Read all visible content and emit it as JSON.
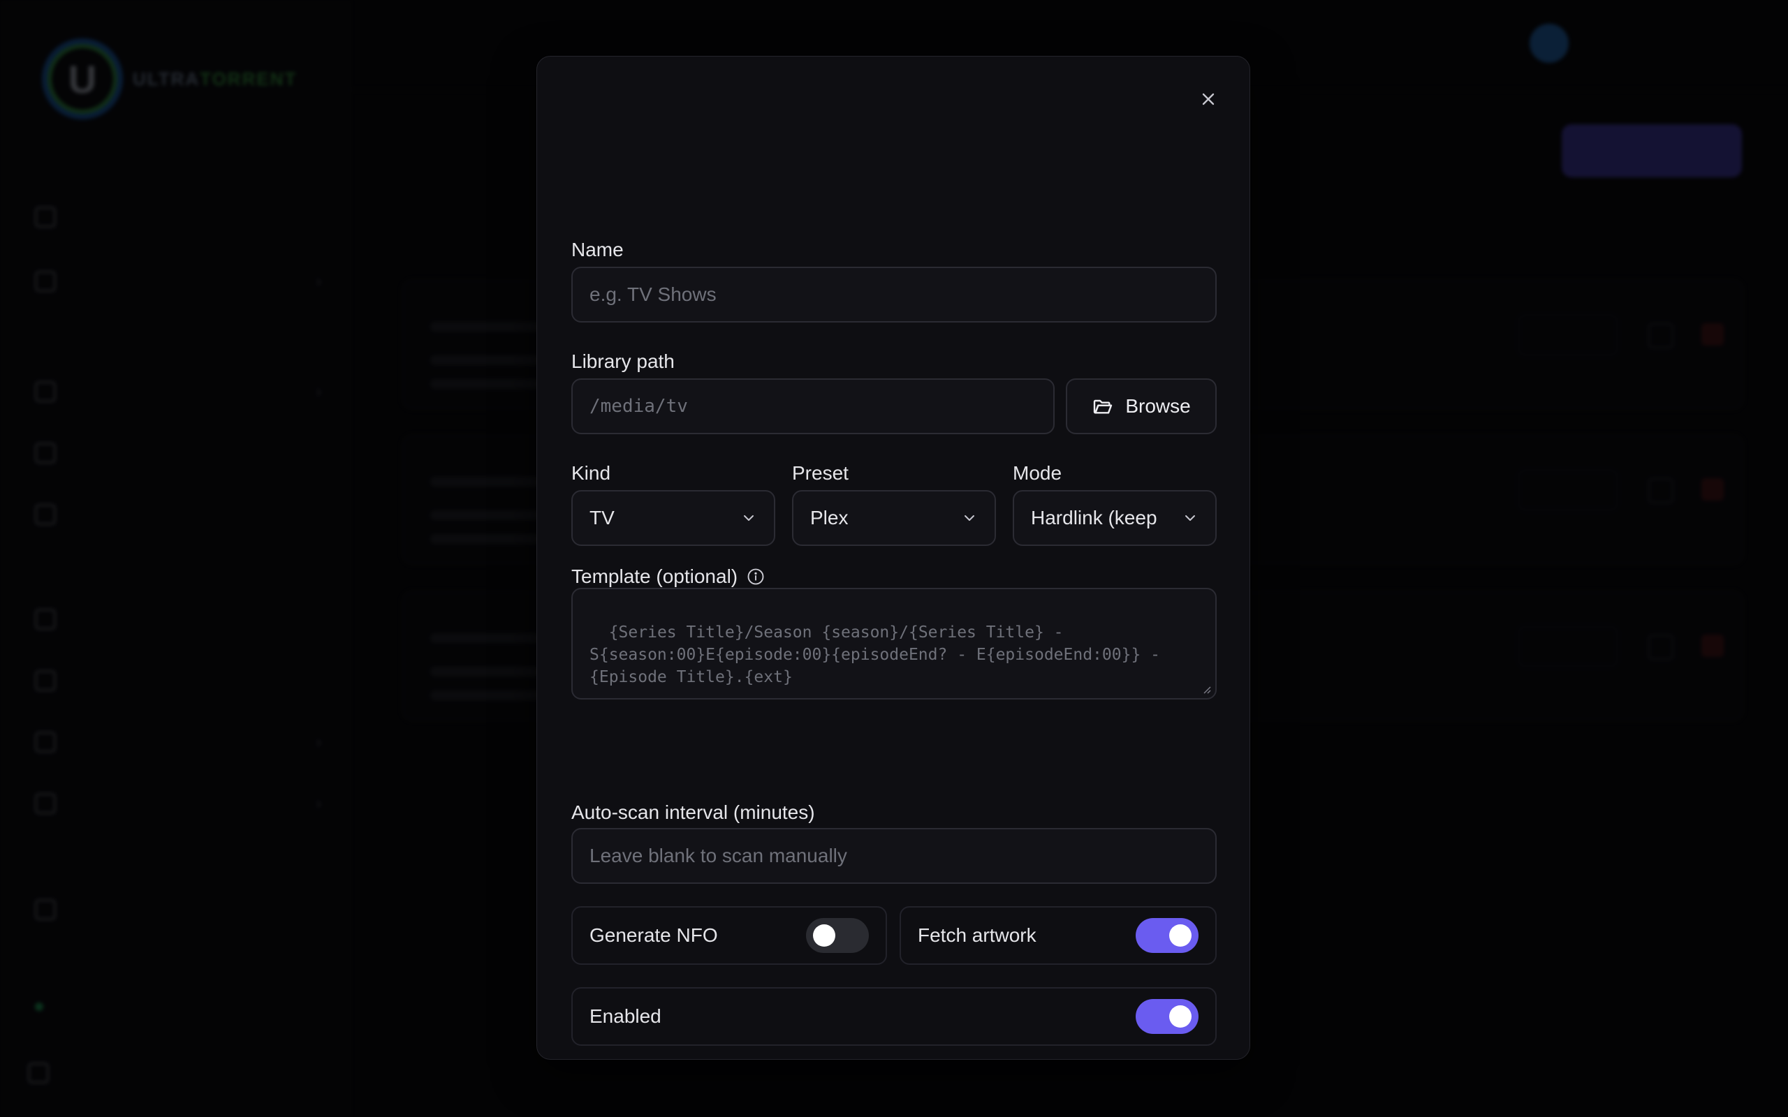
{
  "dialog": {
    "name_label": "Name",
    "name_placeholder": "e.g. TV Shows",
    "path_label": "Library path",
    "path_placeholder": "/media/tv",
    "browse_label": "Browse",
    "kind_label": "Kind",
    "kind_value": "TV",
    "preset_label": "Preset",
    "preset_value": "Plex",
    "mode_label": "Mode",
    "mode_value": "Hardlink (keep",
    "template_label": "Template (optional)",
    "template_placeholder": "{Series Title}/Season {season}/{Series Title} - S{season:00}E{episode:00}{episodeEnd? - E{episodeEnd:00}} - {Episode Title}.{ext}",
    "interval_label": "Auto-scan interval (minutes)",
    "interval_placeholder": "Leave blank to scan manually",
    "toggles": [
      {
        "label": "Generate NFO",
        "on": false
      },
      {
        "label": "Fetch artwork",
        "on": true
      },
      {
        "label": "Enabled",
        "on": true
      }
    ],
    "accent_color": "#6a5cf0"
  }
}
